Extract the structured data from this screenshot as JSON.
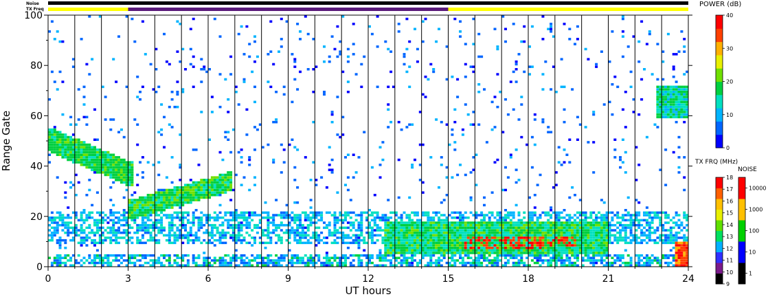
{
  "header": {
    "noise_label": "Noise",
    "txfreq_label": "TX Freq"
  },
  "chart_data": {
    "type": "heatmap",
    "title": "",
    "xlabel": "UT hours",
    "ylabel": "Range Gate",
    "xlim": [
      0,
      24
    ],
    "ylim": [
      0,
      100
    ],
    "x_ticks": [
      "0",
      "3",
      "6",
      "9",
      "12",
      "15",
      "18",
      "21",
      "24"
    ],
    "y_ticks": [
      "0",
      "20",
      "40",
      "60",
      "80",
      "100"
    ],
    "scan_boundaries_hours": [
      1,
      2,
      3,
      4,
      5,
      6,
      7,
      8,
      9,
      10,
      11,
      12,
      13,
      14,
      15,
      16,
      17,
      18,
      19,
      20,
      21,
      22,
      23
    ],
    "noise_bar": {
      "color": "#000000",
      "start": 0,
      "end": 24
    },
    "txfreq_bar": [
      {
        "start": 0,
        "end": 3,
        "color": "#ffff00"
      },
      {
        "start": 3,
        "end": 15,
        "color": "#5a1a7a"
      },
      {
        "start": 15,
        "end": 24,
        "color": "#ffff00"
      }
    ],
    "colorbars": [
      {
        "title": "POWER (dB)",
        "ticks": [
          "0",
          "10",
          "20",
          "30",
          "40"
        ],
        "range": [
          0,
          40
        ],
        "colors": [
          "#0000ff",
          "#0066ff",
          "#00b4ff",
          "#00e0c0",
          "#00d040",
          "#70e000",
          "#e8f000",
          "#ffb000",
          "#ff4000",
          "#ff0000"
        ]
      },
      {
        "title": "TX FRQ (MHz)",
        "ticks": [
          "9",
          "10",
          "11",
          "12",
          "13",
          "14",
          "15",
          "16",
          "17",
          "18"
        ],
        "colors": [
          "#000000",
          "#7a1a8a",
          "#3030ff",
          "#00b0ff",
          "#00e060",
          "#60e000",
          "#e8f000",
          "#ffc000",
          "#ff6000",
          "#ff0000"
        ]
      },
      {
        "title": "NOISE",
        "ticks": [
          "1",
          "10",
          "100",
          "1000",
          "10000"
        ],
        "colors": [
          "#000000",
          "#0000ff",
          "#00d000",
          "#ffc000",
          "#ff0000"
        ]
      }
    ],
    "echo_regions": [
      {
        "x0": 0.0,
        "x1": 3.0,
        "y0": 50,
        "y1": 36,
        "power": 16,
        "label": "descending band"
      },
      {
        "x0": 3.0,
        "x1": 6.5,
        "y0": 22,
        "y1": 33,
        "power": 18,
        "label": "rising band"
      },
      {
        "x0": 12.5,
        "x1": 21.0,
        "y0": 5,
        "y1": 18,
        "power": 30,
        "label": "strong low-range echoes"
      },
      {
        "x0": 23.0,
        "x1": 24.0,
        "y0": 60,
        "y1": 70,
        "power": 14,
        "label": "late echoes"
      }
    ]
  }
}
